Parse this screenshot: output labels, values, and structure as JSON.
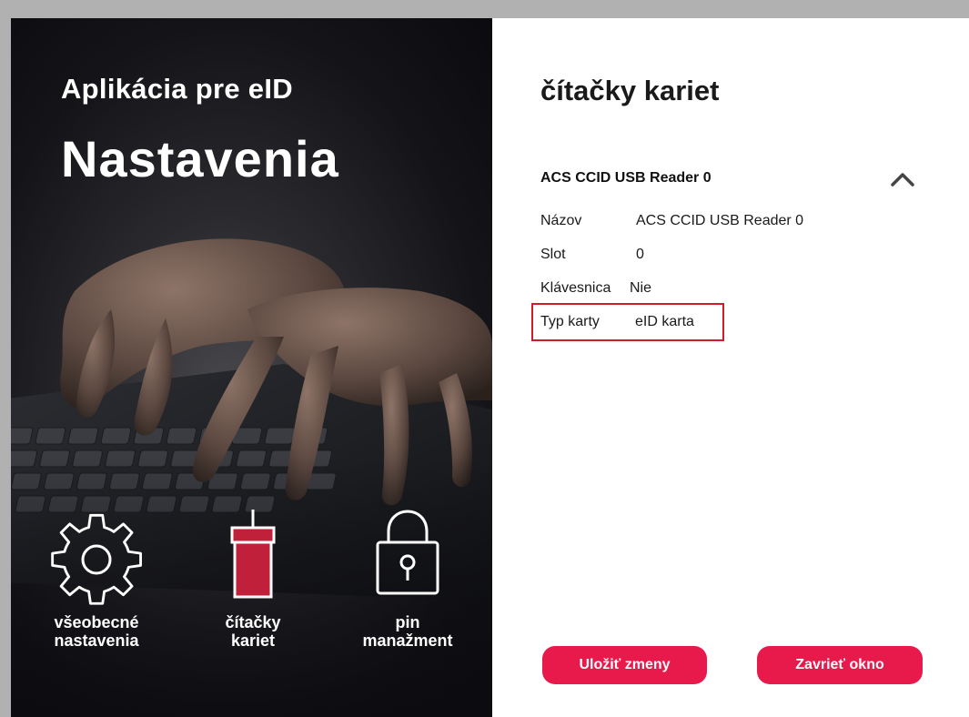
{
  "sidebar": {
    "app_title": "Aplikácia pre eID",
    "page_title": "Nastavenia",
    "nav": [
      {
        "label": "všeobecné\nnastavenia",
        "icon": "gear-icon",
        "active": false
      },
      {
        "label": "čítačky\nkariet",
        "icon": "card-reader-icon",
        "active": true
      },
      {
        "label": "pin\nmanažment",
        "icon": "lock-icon",
        "active": false
      }
    ]
  },
  "main": {
    "section_title": "čítačky kariet",
    "reader": {
      "name": "ACS CCID USB Reader 0",
      "expanded": true,
      "details": [
        {
          "label": "Názov",
          "value": "ACS CCID USB Reader 0"
        },
        {
          "label": "Slot",
          "value": "0"
        },
        {
          "label": "Klávesnica",
          "value": "Nie"
        },
        {
          "label": "Typ karty",
          "value": "eID karta"
        }
      ]
    },
    "buttons": {
      "save": "Uložiť zmeny",
      "close": "Zavrieť okno"
    }
  },
  "colors": {
    "accent": "#e8194b",
    "highlight_border": "#d11a2a",
    "reader_icon": "#c1203a",
    "panel_dark": "#141418"
  }
}
